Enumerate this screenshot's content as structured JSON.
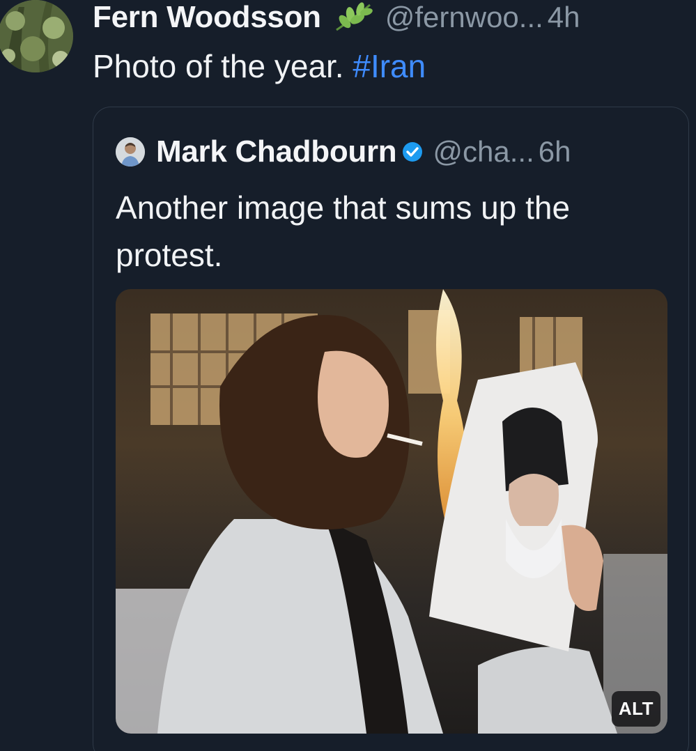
{
  "post": {
    "author_name": "Fern Woodsson",
    "author_handle": "@fernwoo...",
    "time": "4h",
    "text": "Photo of the year.",
    "hashtag": "#Iran",
    "author_badge_icon": "leaf-emoji-icon"
  },
  "quote": {
    "author_name": "Mark Chadbourn",
    "author_handle": "@cha...",
    "time": "6h",
    "text": "Another image that sums up the protest.",
    "verified_icon": "verified-badge-icon",
    "verified_color": "#1d9bf0",
    "media_alt_label": "ALT"
  },
  "colors": {
    "background": "#161e2a",
    "hashtag": "#3f8cff",
    "muted": "#8b98a5"
  }
}
